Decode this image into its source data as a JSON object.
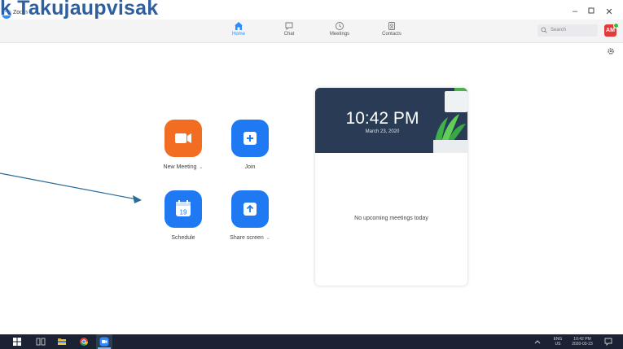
{
  "overlay": {
    "title": "k Takujaupvisak"
  },
  "window": {
    "app_name": "Zoom",
    "controls": {
      "minimize": "–",
      "maximize": "▫",
      "close": "✕"
    }
  },
  "nav": {
    "tabs": [
      {
        "label": "Home",
        "icon": "home-icon",
        "active": true
      },
      {
        "label": "Chat",
        "icon": "chat-icon",
        "active": false
      },
      {
        "label": "Meetings",
        "icon": "clock-icon",
        "active": false
      },
      {
        "label": "Contacts",
        "icon": "contacts-icon",
        "active": false
      }
    ],
    "search_label": "Search",
    "avatar_initials": "AM"
  },
  "actions": {
    "new_meeting": "New Meeting",
    "join": "Join",
    "schedule": "Schedule",
    "schedule_day": "19",
    "share_screen": "Share screen",
    "chevron": "⌄"
  },
  "calendar": {
    "time": "10:42 PM",
    "date": "March 23, 2020",
    "empty_message": "No upcoming meetings today"
  },
  "taskbar": {
    "lang": "ENG",
    "region": "US",
    "time": "10:42 PM",
    "date": "2020-03-23"
  },
  "colors": {
    "accent": "#2d8cff",
    "orange": "#f26d21",
    "button_blue": "#1e79f2",
    "card_header": "#2a3b55",
    "taskbar": "#1a2233"
  }
}
